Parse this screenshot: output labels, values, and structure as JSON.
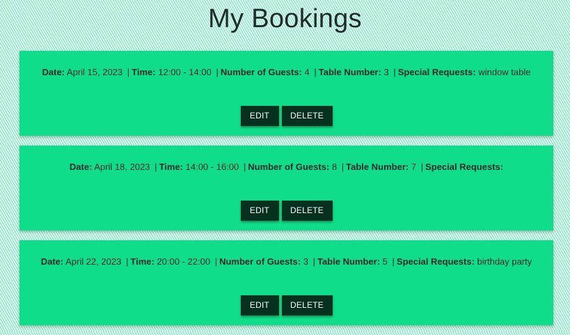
{
  "page": {
    "title": "My Bookings"
  },
  "labels": {
    "date": "Date:",
    "time": "Time:",
    "guests": "Number of Guests:",
    "table": "Table Number:",
    "requests": "Special Requests:",
    "separator": "|"
  },
  "bookings": [
    {
      "date": "April 15, 2023",
      "time": "12:00 - 14:00",
      "guests": "4",
      "table": "3",
      "requests": "window table",
      "edit_label": "EDIT",
      "delete_label": "DELETE"
    },
    {
      "date": "April 18, 2023",
      "time": "14:00 - 16:00",
      "guests": "8",
      "table": "7",
      "requests": "",
      "edit_label": "EDIT",
      "delete_label": "DELETE"
    },
    {
      "date": "April 22, 2023",
      "time": "20:00 - 22:00",
      "guests": "3",
      "table": "5",
      "requests": "birthday party",
      "edit_label": "EDIT",
      "delete_label": "DELETE"
    }
  ],
  "colors": {
    "card_background": "#10dd89",
    "button_background": "#06311f",
    "button_text": "#ffffff",
    "text": "#1f2a2a"
  }
}
